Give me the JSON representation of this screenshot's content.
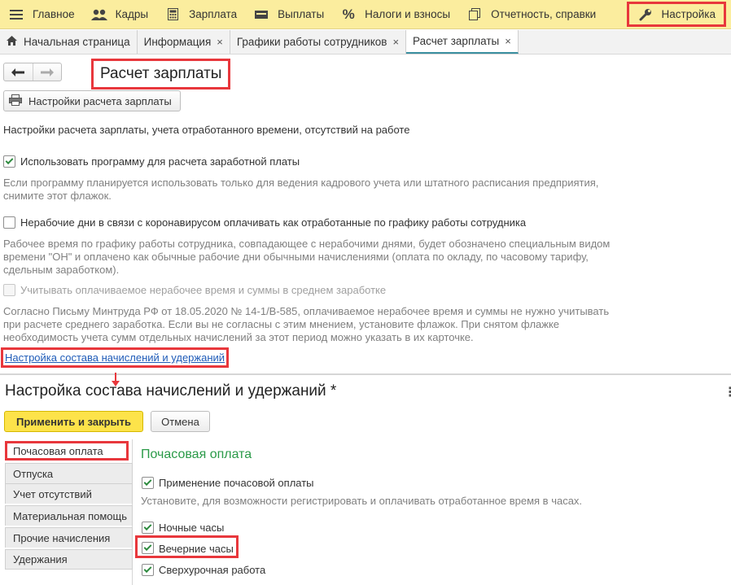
{
  "top_menu": {
    "items": [
      {
        "label": "Главное",
        "icon": "menu-lines-icon"
      },
      {
        "label": "Кадры",
        "icon": "people-icon"
      },
      {
        "label": "Зарплата",
        "icon": "calculator-icon"
      },
      {
        "label": "Выплаты",
        "icon": "wallet-icon"
      },
      {
        "label": "Налоги и взносы",
        "icon": "percent-icon"
      },
      {
        "label": "Отчетность, справки",
        "icon": "documents-icon"
      },
      {
        "label": "Настройка",
        "icon": "wrench-icon"
      }
    ]
  },
  "tabs": [
    {
      "label": "Начальная страница",
      "closable": false
    },
    {
      "label": "Информация",
      "closable": true
    },
    {
      "label": "Графики работы сотрудников",
      "closable": true
    },
    {
      "label": "Расчет зарплаты",
      "closable": true,
      "active": true
    }
  ],
  "close_glyph": "×",
  "nav": {
    "back": "🡐",
    "forward": "🡒"
  },
  "page": {
    "title": "Расчет зарплаты",
    "settings_button": "Настройки расчета зарплаты",
    "heading": "Настройки расчета зарплаты, учета отработанного времени, отсутствий на работе",
    "options": [
      {
        "label": "Использовать программу для расчета заработной платы",
        "checked": true
      },
      {
        "label": "Нерабочие дни в связи с коронавирусом оплачивать как отработанные по графику работы сотрудника",
        "checked": false
      },
      {
        "label": "Учитывать оплачиваемое нерабочее время и суммы в среднем заработке",
        "checked": false,
        "disabled": true
      }
    ],
    "hint1": [
      "Если программу планируется использовать только для ведения кадрового учета или штатного расписания предприятия,",
      "снимите этот флажок."
    ],
    "hint2": [
      "Рабочее время по графику работы сотрудника, совпадающее с нерабочими днями, будет обозначено специальным видом",
      "времени \"ОН\" и оплачено как обычные рабочие дни обычными начислениями (оплата по окладу, по часовому тарифу,",
      "сдельным заработком)."
    ],
    "hint3": [
      "Согласно Письму Минтруда РФ от 18.05.2020 № 14-1/В-585, оплачиваемое нерабочее время и суммы не нужно учитывать",
      "при расчете среднего заработка. Если вы не согласны с этим мнением, установите флажок. При снятом флажке",
      "необходимость учета сумм отдельных начислений за этот период можно указать в их карточке."
    ],
    "link": "Настройка состава начислений и удержаний"
  },
  "dialog": {
    "title": "Настройка состава начислений и удержаний *",
    "more": "⋮",
    "apply_button": "Применить и закрыть",
    "cancel_button": "Отмена",
    "sidebar": [
      "Почасовая оплата",
      "Отпуска",
      "Учет отсутствий",
      "Материальная помощь",
      "Прочие начисления",
      "Удержания"
    ],
    "section_title": "Почасовая оплата",
    "options": [
      {
        "label": "Применение почасовой оплаты",
        "checked": true
      },
      {
        "label": "Ночные часы",
        "checked": true
      },
      {
        "label": "Вечерние часы",
        "checked": true
      },
      {
        "label": "Сверхурочная работа",
        "checked": true
      }
    ],
    "hourly_hint": "Установите, для возможности регистрировать и оплачивать отработанное время в часах."
  },
  "colors": {
    "menu_bg": "#fbed9e",
    "highlight": "#e8373c",
    "link": "#1f5bb8",
    "section_title": "#2a9a48",
    "check": "#2d8a3e",
    "apply_bg": "#fde34a"
  }
}
